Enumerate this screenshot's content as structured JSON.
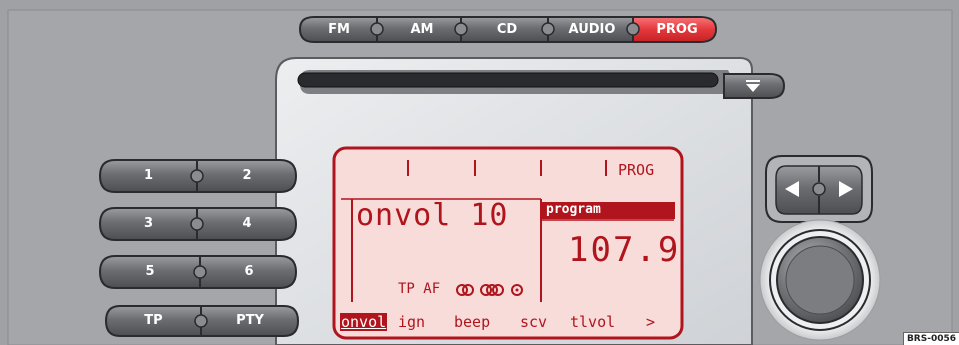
{
  "source_buttons": [
    {
      "label": "FM",
      "active": false
    },
    {
      "label": "AM",
      "active": false
    },
    {
      "label": "CD",
      "active": false
    },
    {
      "label": "AUDIO",
      "active": false
    },
    {
      "label": "PROG",
      "active": true
    }
  ],
  "preset_buttons": [
    {
      "left": "1",
      "right": "2"
    },
    {
      "left": "3",
      "right": "4"
    },
    {
      "left": "5",
      "right": "6"
    },
    {
      "left": "TP",
      "right": "PTY"
    }
  ],
  "eject_icon": "eject-triangle-icon",
  "nav_icons": {
    "left": "arrow-left-icon",
    "right": "arrow-right-icon"
  },
  "display": {
    "top_mode": "PROG",
    "main_text": "onvol 10",
    "header_box": "program",
    "frequency": "107.9",
    "status_text": "TP AF",
    "menu_items": [
      "onvol",
      "ign",
      "beep",
      "scv",
      "tlvol"
    ],
    "menu_selected": 0,
    "menu_more": ">"
  },
  "colors": {
    "lcd_text": "#b0151d",
    "lcd_background": "#f6d9d7",
    "active_button": "#e8383c",
    "button": "#6c6e72"
  },
  "reference": "BRS-0056"
}
